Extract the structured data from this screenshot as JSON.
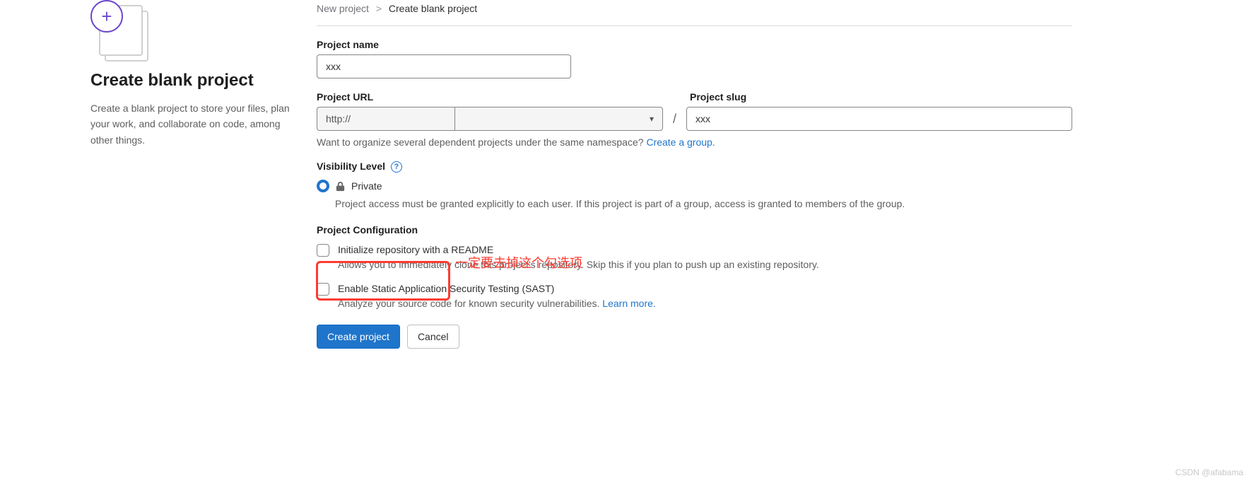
{
  "left": {
    "title": "Create blank project",
    "description": "Create a blank project to store your files, plan your work, and collaborate on code, among other things."
  },
  "breadcrumbs": {
    "parent": "New project",
    "separator": ">",
    "current": "Create blank project"
  },
  "form": {
    "project_name_label": "Project name",
    "project_name_value": "xxx",
    "project_url_label": "Project URL",
    "project_url_prefix": "http://",
    "project_slug_label": "Project slug",
    "project_slug_value": "xxx",
    "namespace_hint_text": "Want to organize several dependent projects under the same namespace? ",
    "namespace_hint_link": "Create a group.",
    "visibility_label": "Visibility Level",
    "visibility_option_private": "Private",
    "visibility_private_desc": "Project access must be granted explicitly to each user. If this project is part of a group, access is granted to members of the group.",
    "config_label": "Project Configuration",
    "readme_label": "Initialize repository with a README",
    "readme_desc": "Allows you to immediately clone this project's repository. Skip this if you plan to push up an existing repository.",
    "sast_label": "Enable Static Application Security Testing (SAST)",
    "sast_desc_text": "Analyze your source code for known security vulnerabilities. ",
    "sast_learn_more": "Learn more.",
    "create_button": "Create project",
    "cancel_button": "Cancel"
  },
  "annotation": {
    "text": "一定要去掉这个勾选项"
  },
  "watermark": "CSDN @afabama"
}
